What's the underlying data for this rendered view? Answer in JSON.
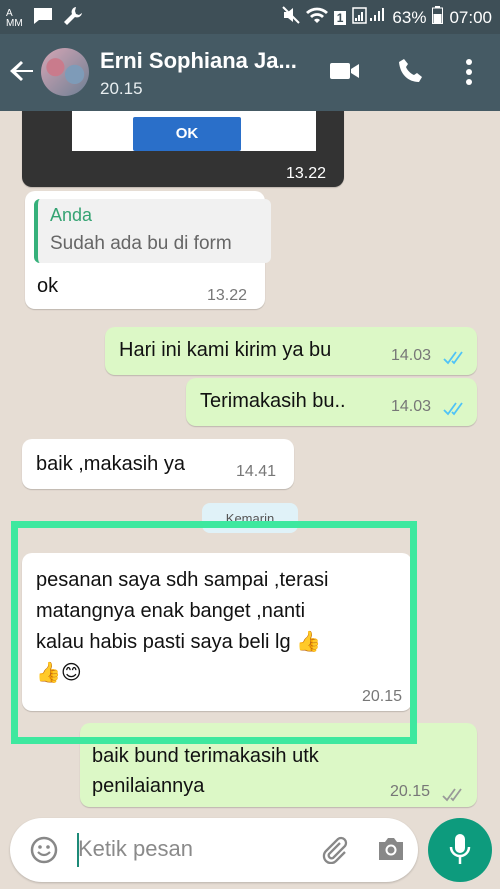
{
  "status_bar": {
    "battery": "63%",
    "time": "07:00",
    "sim_badge": "1"
  },
  "header": {
    "contact_name": "Erni Sophiana Ja...",
    "contact_status": "20.15"
  },
  "messages": [
    {
      "type": "image",
      "dialog_button": "OK",
      "time": "13.22"
    },
    {
      "type": "reply",
      "quote_author": "Anda",
      "quote_text": "Sudah ada bu di form",
      "text": "ok",
      "time": "13.22"
    },
    {
      "type": "outgoing",
      "text": "Hari ini kami kirim ya bu",
      "time": "14.03"
    },
    {
      "type": "outgoing",
      "text": "Terimakasih bu..",
      "time": "14.03"
    },
    {
      "type": "incoming",
      "text": "baik ,makasih ya",
      "time": "14.41"
    },
    {
      "type": "date_chip",
      "text": "Kemarin"
    },
    {
      "type": "incoming",
      "lines": [
        "pesanan saya sdh sampai ,terasi",
        "matangnya enak banget ,nanti",
        "kalau habis pasti saya beli lg 👍",
        "👍😊"
      ],
      "time": "20.15"
    },
    {
      "type": "outgoing",
      "lines": [
        "baik bund terimakasih utk",
        "penilaiannya"
      ],
      "time": "20.15"
    }
  ],
  "input": {
    "placeholder": "Ketik pesan"
  },
  "colors": {
    "header": "#455a64",
    "status_bar": "#3e4f57",
    "outgoing_bubble": "#dcf8c6",
    "accent": "#0d9b7d",
    "highlight": "#3ee89f",
    "read_ticks": "#4fc3f7"
  },
  "icons": [
    "back-arrow-icon",
    "video-call-icon",
    "phone-icon",
    "more-vert-icon",
    "emoji-icon",
    "attach-icon",
    "camera-icon",
    "mic-icon"
  ]
}
